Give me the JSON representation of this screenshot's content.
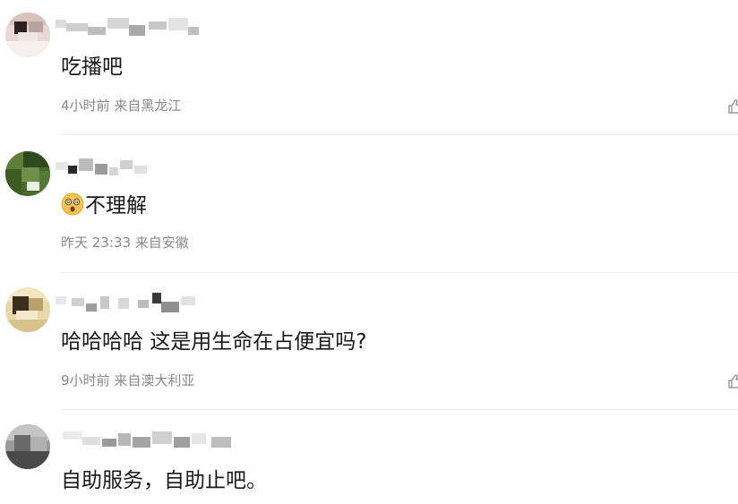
{
  "comments": [
    {
      "text": "吃播吧",
      "time": "4小时前",
      "location": "来自黑龙江"
    },
    {
      "emoji_icon": "dizzy-face-icon",
      "text": "不理解",
      "time": "昨天 23:33",
      "location": "来自安徽"
    },
    {
      "text": "哈哈哈哈 这是用生命在占便宜吗?",
      "time": "9小时前",
      "location": "来自澳大利亚"
    },
    {
      "text": "自助服务，自助止吧。"
    }
  ],
  "icons": {
    "like": "thumbs-up-icon",
    "avatar": "avatar",
    "username": "username-pixelated"
  },
  "colors": {
    "meta_text": "#8a8a8a",
    "divider": "#ececec",
    "emoji": "#f6c44f"
  }
}
